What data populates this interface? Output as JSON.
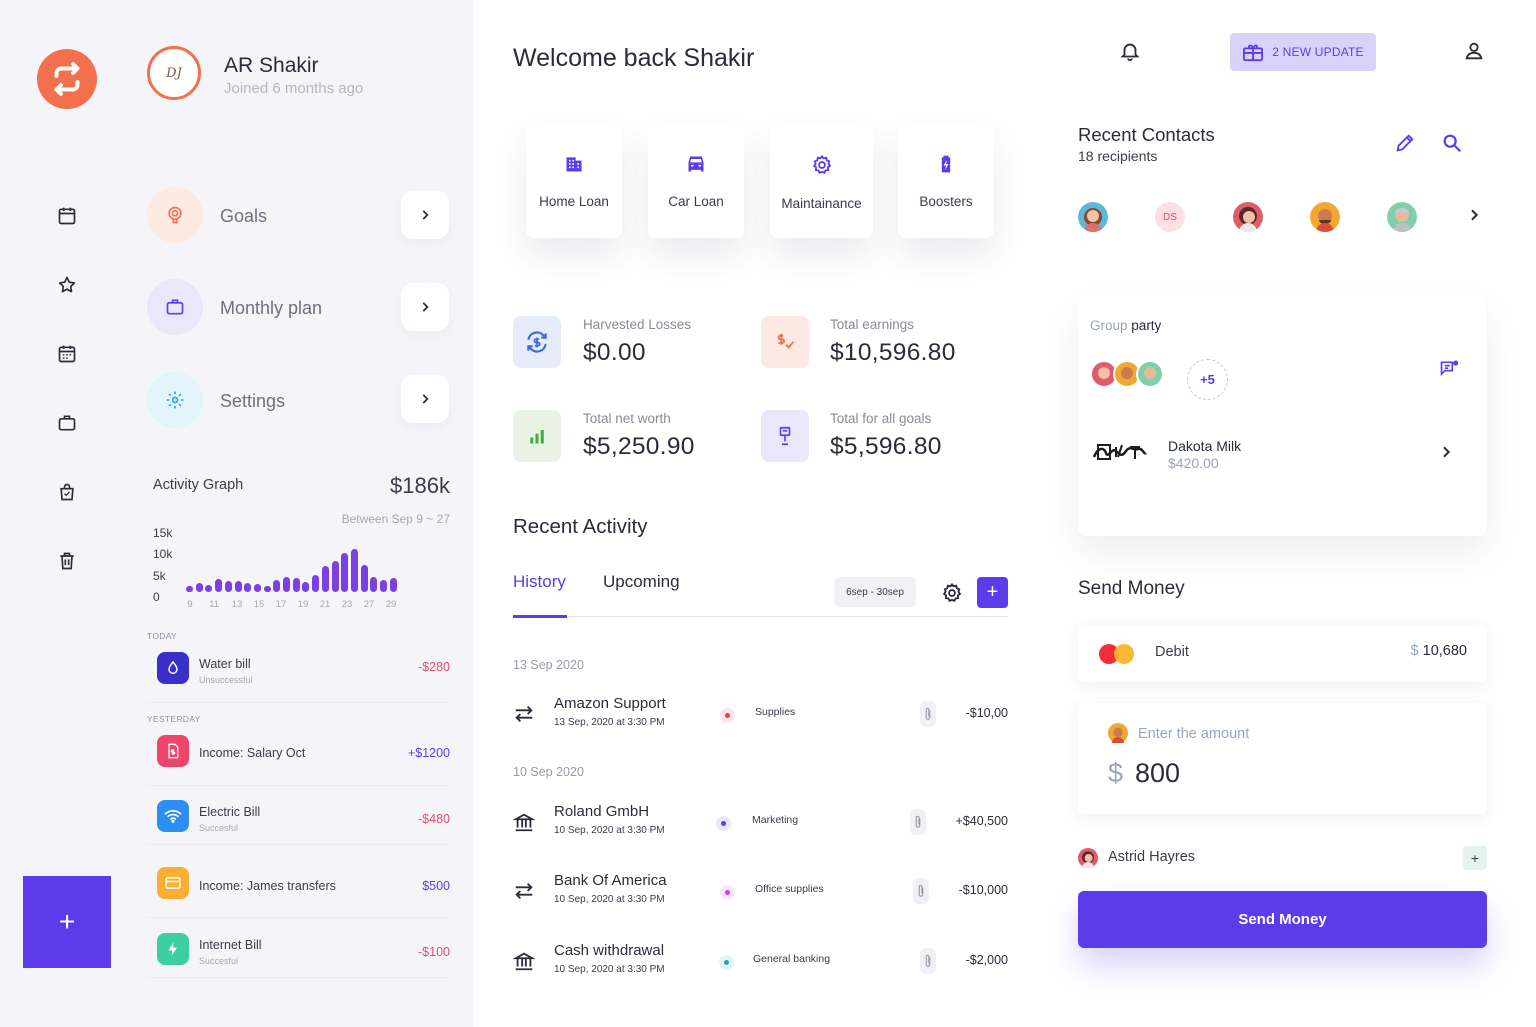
{
  "profile": {
    "name": "AR Shakir",
    "joined": "Joined 6 months ago",
    "signature": "DJ"
  },
  "menu": [
    {
      "label": "Goals",
      "icon": "target-icon"
    },
    {
      "label": "Monthly plan",
      "icon": "briefcase-icon"
    },
    {
      "label": "Settings",
      "icon": "gear-icon"
    }
  ],
  "activity_graph": {
    "title": "Activity Graph",
    "total": "$186k",
    "range": "Between Sep 9 ~ 27",
    "y_ticks": [
      "15k",
      "10k",
      "5k",
      "0"
    ],
    "x_ticks": [
      "9",
      "11",
      "13",
      "15",
      "17",
      "19",
      "21",
      "23",
      "27",
      "29"
    ]
  },
  "chart_data": {
    "type": "bar",
    "title": "Activity Graph",
    "ylim": [
      0,
      15000
    ],
    "values": [
      1500,
      2200,
      1600,
      3000,
      2600,
      2500,
      2200,
      1800,
      900,
      2900,
      3500,
      3200,
      2300,
      3900,
      6200,
      7200,
      9200,
      10000,
      6400,
      3500,
      2700,
      3300
    ]
  },
  "sidebar_tx": {
    "today_label": "TODAY",
    "yesterday_label": "YESTERDAY",
    "items": [
      {
        "name": "Water bill",
        "sub": "Unsuccessful",
        "amount": "-$280",
        "color": "#e44e6c",
        "icon": "water-drop-icon",
        "bg": "#3b2fc9"
      },
      {
        "name": "Income: Salary Oct",
        "sub": "",
        "amount": "+$1200",
        "color": "#5c3bea",
        "icon": "document-dollar-icon",
        "bg": "#f0456b"
      },
      {
        "name": "Electric Bill",
        "sub": "Succesful",
        "amount": "-$480",
        "color": "#e44e6c",
        "icon": "wifi-icon",
        "bg": "#2c8df2"
      },
      {
        "name": "Income: James transfers",
        "sub": "",
        "amount": "$500",
        "color": "#5c3bea",
        "icon": "card-icon",
        "bg": "#fcae30"
      },
      {
        "name": "Internet Bill",
        "sub": "Succesful",
        "amount": "-$100",
        "color": "#e44e6c",
        "icon": "bolt-icon",
        "bg": "#3ecfa1"
      }
    ]
  },
  "header": {
    "welcome": "Welcome back Shakir",
    "update_label": "2 NEW UPDATE"
  },
  "services": [
    {
      "label": "Home Loan",
      "icon": "building-icon"
    },
    {
      "label": "Car Loan",
      "icon": "car-icon"
    },
    {
      "label": "Maintainance",
      "icon": "gear-icon"
    },
    {
      "label": "Boosters",
      "icon": "battery-icon"
    }
  ],
  "stats": [
    {
      "label": "Harvested Losses",
      "value": "$0.00",
      "icon": "sync-dollar-icon",
      "bg": "#e6ebf9",
      "fg": "#3b6ad9"
    },
    {
      "label": "Total earnings",
      "value": "$10,596.80",
      "icon": "dollar-check-icon",
      "bg": "#fde9e3",
      "fg": "#f2704b"
    },
    {
      "label": "Total net worth",
      "value": "$5,250.90",
      "icon": "bar-chart-icon",
      "bg": "#e9f3e5",
      "fg": "#3fae38"
    },
    {
      "label": "Total for all goals",
      "value": "$5,596.80",
      "icon": "award-icon",
      "bg": "#ebe7fb",
      "fg": "#5c3bea"
    }
  ],
  "recent_activity": {
    "title": "Recent Activity",
    "tabs": [
      "History",
      "Upcoming"
    ],
    "date_range": "6sep - 30sep",
    "groups": [
      {
        "date": "13 Sep 2020",
        "items": [
          {
            "name": "Amazon Support",
            "time": "13 Sep, 2020 at 3:30 PM",
            "category": "Supplies",
            "dot": "#f2394f",
            "amount": "-$10,00",
            "icon": "transfer-icon"
          }
        ]
      },
      {
        "date": "10 Sep 2020",
        "items": [
          {
            "name": "Roland GmbH",
            "time": "10 Sep, 2020 at 3:30 PM",
            "category": "Marketing",
            "dot": "#5c3bea",
            "amount": "+$40,500",
            "icon": "bank-icon"
          },
          {
            "name": "Bank Of America",
            "time": "10 Sep, 2020 at 3:30 PM",
            "category": "Office supplies",
            "dot": "#d43bea",
            "amount": "-$10,000",
            "icon": "transfer-icon"
          },
          {
            "name": "Cash withdrawal",
            "time": "10 Sep, 2020 at 3:30 PM",
            "category": "General banking",
            "dot": "#1fa5b8",
            "amount": "-$2,000",
            "icon": "bank-icon"
          }
        ]
      }
    ]
  },
  "recent_contacts": {
    "title": "Recent Contacts",
    "subtitle": "18 recipients",
    "initials": "DS"
  },
  "group_party": {
    "label_a": "Group",
    "label_b": "party",
    "more": "+5",
    "payee": "Dakota Milk",
    "payee_amount": "$420.00",
    "payee_logo": "Dakota Milk logo"
  },
  "send_money": {
    "title": "Send Money",
    "card_label": "Debit",
    "balance_sym": "$",
    "balance": "10,680",
    "amount_placeholder": "Enter the amount",
    "currency": "$",
    "amount": "800",
    "recipient": "Astrid Hayres",
    "button": "Send Money"
  }
}
